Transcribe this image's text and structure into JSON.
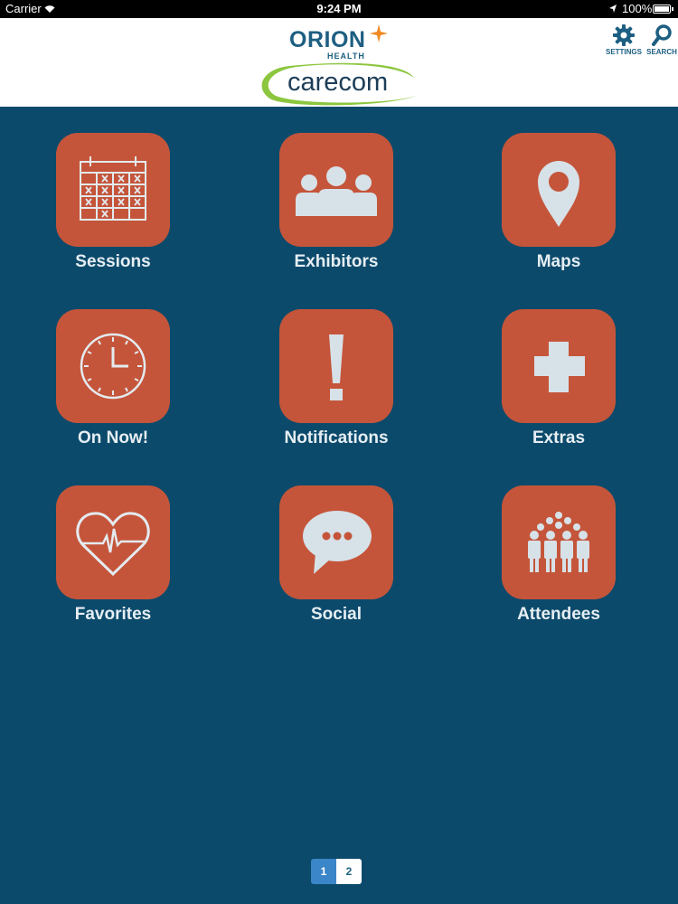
{
  "status_bar": {
    "carrier": "Carrier",
    "time": "9:24 PM",
    "battery": "100%"
  },
  "header": {
    "logo_primary": "ORION",
    "logo_primary_sub": "HEALTH",
    "logo_secondary": "carecom",
    "settings_label": "SETTINGS",
    "search_label": "SEARCH"
  },
  "grid": {
    "items": [
      {
        "label": "Sessions",
        "icon": "calendar-icon"
      },
      {
        "label": "Exhibitors",
        "icon": "group-icon"
      },
      {
        "label": "Maps",
        "icon": "map-pin-icon"
      },
      {
        "label": "On Now!",
        "icon": "clock-icon"
      },
      {
        "label": "Notifications",
        "icon": "exclamation-icon"
      },
      {
        "label": "Extras",
        "icon": "plus-icon"
      },
      {
        "label": "Favorites",
        "icon": "heart-pulse-icon"
      },
      {
        "label": "Social",
        "icon": "chat-bubble-icon"
      },
      {
        "label": "Attendees",
        "icon": "crowd-icon"
      }
    ]
  },
  "pager": {
    "pages": [
      "1",
      "2"
    ],
    "current": "1"
  },
  "colors": {
    "background": "#0c4a6b",
    "tile": "#c5553a",
    "icon": "#d7e1e8",
    "pager_active": "#3a86c8"
  }
}
